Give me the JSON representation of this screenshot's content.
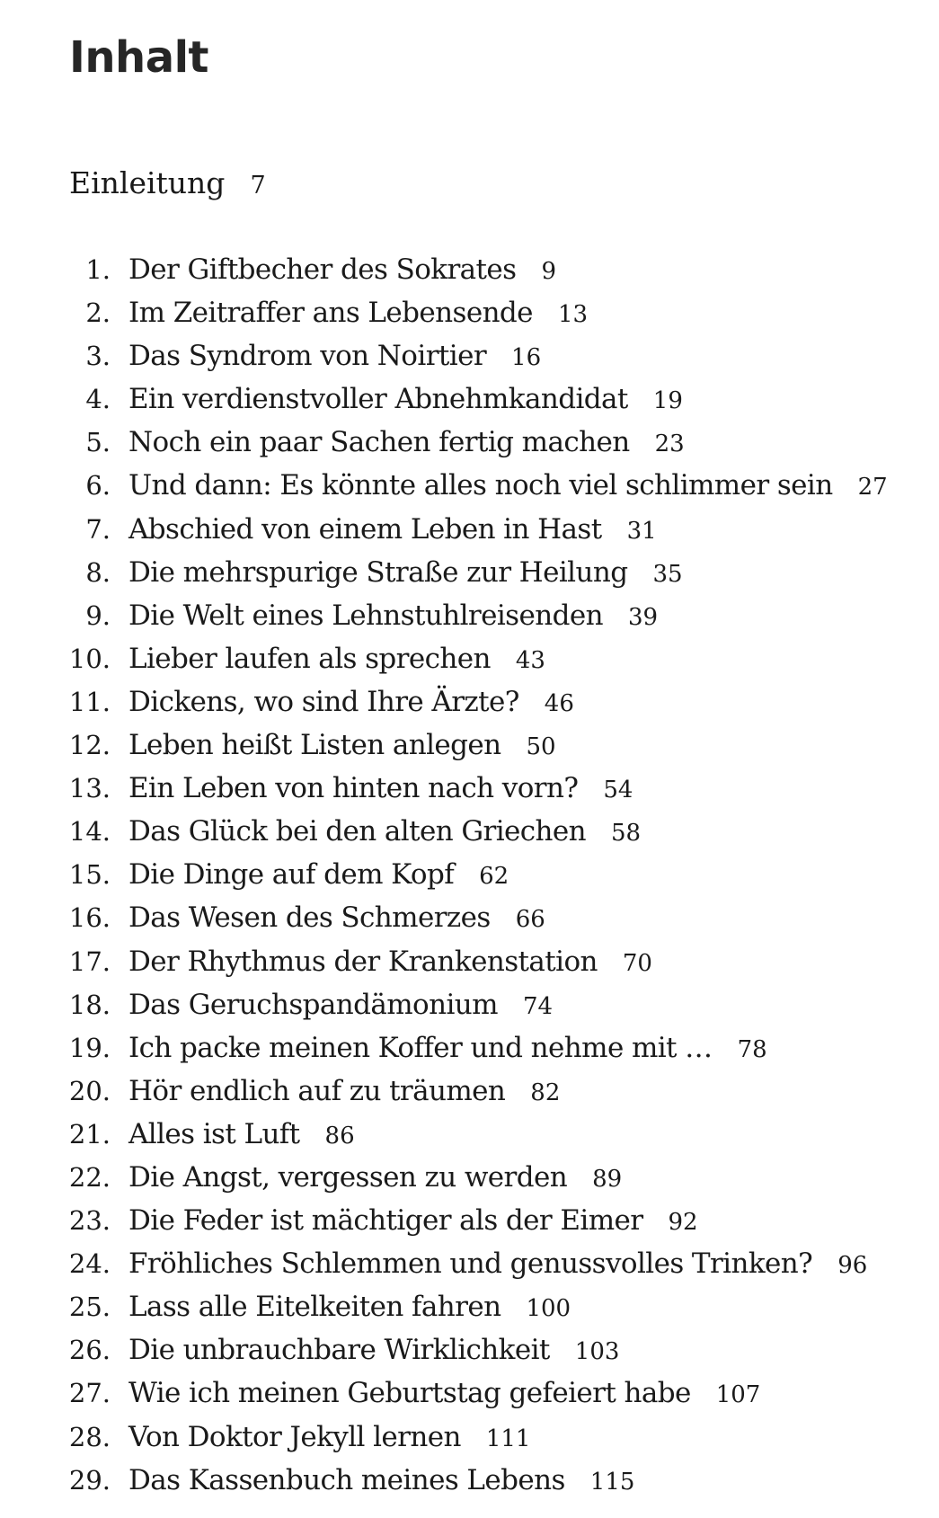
{
  "heading": "Inhalt",
  "intro": {
    "title": "Einleitung",
    "page": "7"
  },
  "entries": [
    {
      "num": "1.",
      "title": "Der Giftbecher des Sokrates",
      "page": "9"
    },
    {
      "num": "2.",
      "title": "Im Zeitraffer ans Lebensende",
      "page": "13"
    },
    {
      "num": "3.",
      "title": "Das Syndrom von Noirtier",
      "page": "16"
    },
    {
      "num": "4.",
      "title": "Ein verdienstvoller Abnehmkandidat",
      "page": "19"
    },
    {
      "num": "5.",
      "title": "Noch ein paar Sachen fertig machen",
      "page": "23"
    },
    {
      "num": "6.",
      "title": "Und dann: Es könnte alles noch viel schlimmer sein",
      "page": "27"
    },
    {
      "num": "7.",
      "title": "Abschied von einem Leben in Hast",
      "page": "31"
    },
    {
      "num": "8.",
      "title": "Die mehrspurige Straße zur Heilung",
      "page": "35"
    },
    {
      "num": "9.",
      "title": "Die Welt eines Lehnstuhlreisenden",
      "page": "39"
    },
    {
      "num": "10.",
      "title": "Lieber laufen als sprechen",
      "page": "43"
    },
    {
      "num": "11.",
      "title": "Dickens, wo sind Ihre Ärzte?",
      "page": "46"
    },
    {
      "num": "12.",
      "title": "Leben heißt Listen anlegen",
      "page": "50"
    },
    {
      "num": "13.",
      "title": "Ein Leben von hinten nach vorn?",
      "page": "54"
    },
    {
      "num": "14.",
      "title": "Das Glück bei den alten Griechen",
      "page": "58"
    },
    {
      "num": "15.",
      "title": "Die Dinge auf dem Kopf",
      "page": "62"
    },
    {
      "num": "16.",
      "title": "Das Wesen des Schmerzes",
      "page": "66"
    },
    {
      "num": "17.",
      "title": "Der Rhythmus der Krankenstation",
      "page": "70"
    },
    {
      "num": "18.",
      "title": "Das Geruchspandämonium",
      "page": "74"
    },
    {
      "num": "19.",
      "title": "Ich packe meinen Koffer und nehme mit …",
      "page": "78"
    },
    {
      "num": "20.",
      "title": "Hör endlich auf zu träumen",
      "page": "82"
    },
    {
      "num": "21.",
      "title": "Alles ist Luft",
      "page": "86"
    },
    {
      "num": "22.",
      "title": "Die Angst, vergessen zu werden",
      "page": "89"
    },
    {
      "num": "23.",
      "title": "Die Feder ist mächtiger als der Eimer",
      "page": "92"
    },
    {
      "num": "24.",
      "title": "Fröhliches Schlemmen und genussvolles Trinken?",
      "page": "96"
    },
    {
      "num": "25.",
      "title": "Lass alle Eitelkeiten fahren",
      "page": "100"
    },
    {
      "num": "26.",
      "title": "Die unbrauchbare Wirklichkeit",
      "page": "103"
    },
    {
      "num": "27.",
      "title": "Wie ich meinen Geburtstag gefeiert habe",
      "page": "107"
    },
    {
      "num": "28.",
      "title": "Von Doktor Jekyll lernen",
      "page": "111"
    },
    {
      "num": "29.",
      "title": "Das Kassenbuch meines Lebens",
      "page": "115"
    }
  ]
}
